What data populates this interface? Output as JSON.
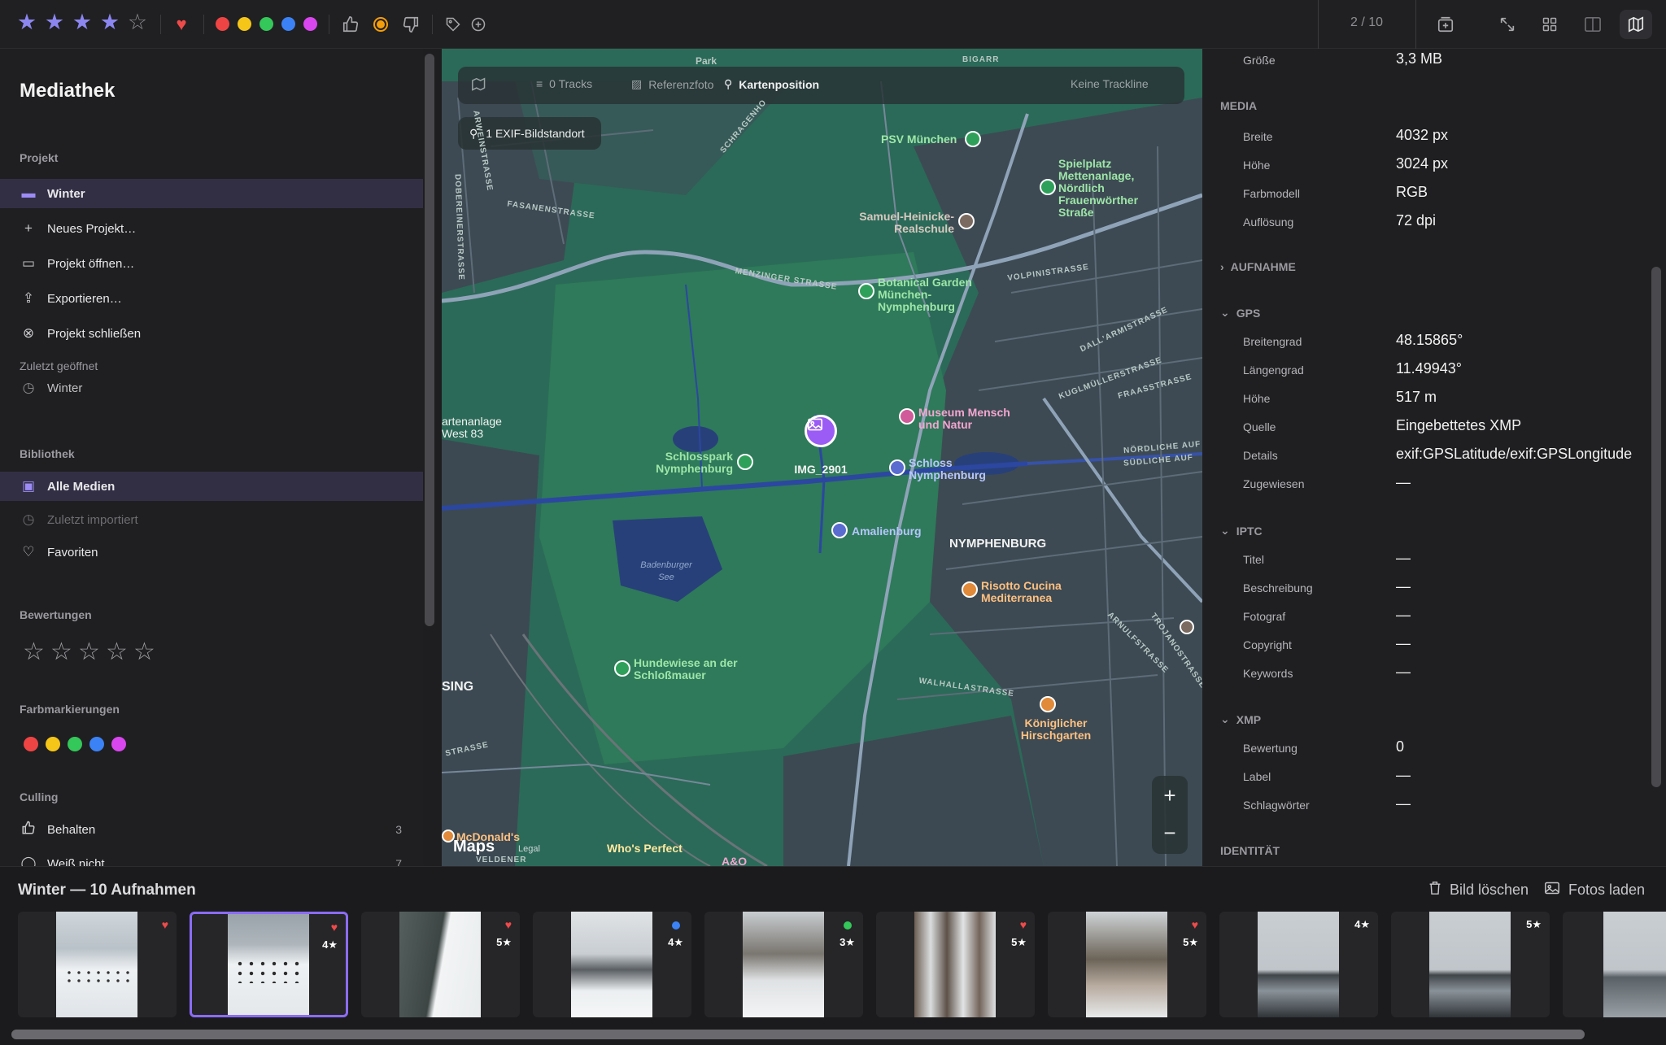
{
  "toolbar": {
    "rating_stars": [
      true,
      true,
      true,
      true,
      false
    ],
    "favorite_icon": "heart-icon",
    "color_labels": [
      "#ef4444",
      "#f5c518",
      "#34c759",
      "#3b82f6",
      "#d946ef"
    ],
    "counter": "2 / 10",
    "actions": [
      "thumbs-up-icon",
      "reject-circle-icon",
      "thumbs-down-icon",
      "tag-icon",
      "add-tag-icon"
    ],
    "right_buttons": [
      "import-icon",
      "fullscreen-icon",
      "grid-view-icon",
      "compare-view-icon",
      "map-view-icon"
    ]
  },
  "sidebar": {
    "title": "Mediathek",
    "project_heading": "Projekt",
    "project_items": [
      {
        "label": "Winter",
        "icon": "folder-icon",
        "selected": true
      },
      {
        "label": "Neues Projekt…",
        "icon": "plus-icon"
      },
      {
        "label": "Projekt öffnen…",
        "icon": "open-folder-icon"
      },
      {
        "label": "Exportieren…",
        "icon": "export-icon"
      },
      {
        "label": "Projekt schließen",
        "icon": "close-circle-icon"
      }
    ],
    "recent_heading": "Zuletzt geöffnet",
    "recent_items": [
      {
        "label": "Winter",
        "icon": "clock-icon"
      }
    ],
    "library_heading": "Bibliothek",
    "library_items": [
      {
        "label": "Alle Medien",
        "icon": "photos-icon",
        "selected": true
      },
      {
        "label": "Zuletzt importiert",
        "icon": "clock-icon",
        "disabled": true
      },
      {
        "label": "Favoriten",
        "icon": "heart-outline-icon"
      }
    ],
    "ratings_heading": "Bewertungen",
    "colors_heading": "Farbmarkierungen",
    "color_filters": [
      "#ef4444",
      "#f5c518",
      "#34c759",
      "#3b82f6",
      "#d946ef"
    ],
    "culling_heading": "Culling",
    "culling_items": [
      {
        "label": "Behalten",
        "count": "3",
        "icon": "thumbs-up-icon"
      },
      {
        "label": "Weiß nicht",
        "count": "7",
        "icon": "question-circle-icon"
      }
    ]
  },
  "map": {
    "bar": {
      "tracks": "0 Tracks",
      "reference": "Referenzfoto",
      "position": "Kartenposition",
      "trackline": "Keine Trackline"
    },
    "exif_pill": "1 EXIF-Bildstandort",
    "pin_label": "IMG_2901",
    "attribution": "Maps",
    "legal": "Legal",
    "labels": {
      "psv": "PSV München",
      "spielplatz": "Spielplatz Mettenanlage, Nördlich Frauenwörther Straße",
      "samuel": "Samuel-Heinicke-Realschule",
      "botanical": "Botanical Garden München-Nymphenburg",
      "museum": "Museum Mensch und Natur",
      "schlosspark": "Schlosspark Nymphenburg",
      "schloss": "Schloss Nymphenburg",
      "amalienburg": "Amalienburg",
      "nymphenburg": "NYMPHENBURG",
      "risotto": "Risotto Cucina Mediterranea",
      "hundewiese": "Hundewiese an der Schloßmauer",
      "koenig": "Königlicher Hirschgarten",
      "gartenanlage": "artenanlage West 83",
      "badenburger": "Badenburger See",
      "mcdonalds": "McDonald's",
      "whos": "Who's Perfect",
      "ao": "A&O",
      "sing": "SING"
    },
    "streets": {
      "menzinger": "MENZINGER STRASSE",
      "volpini": "VOLPINISTRASSE",
      "dall": "DALL'ARMISTRASSE",
      "kugl": "KUGLMÜLLERSTRASSE",
      "fraass": "FRAASSTRASSE",
      "nord": "NÖRDLICHE AUF",
      "sued": "SÜDLICHE AUF",
      "walhalla": "WALHALLASTRASSE",
      "arnulf": "ARNULFSTRASSE",
      "trojano": "TROJANOSTRASSE",
      "fasanen": "FASANENSTRASSE",
      "schragen": "SCHRAGENHO",
      "dobere": "DOBEREINERSTRASSE",
      "arwein": "ARWEINSTRASSE",
      "park": "Park",
      "bigarr": "BIGARR",
      "strasse": "STRASSE",
      "veldener": "VELDENER"
    }
  },
  "panel": {
    "top_rows": [
      {
        "key": "Größe",
        "value": "3,3 MB"
      }
    ],
    "media_heading": "MEDIA",
    "media_rows": [
      {
        "key": "Breite",
        "value": "4032 px"
      },
      {
        "key": "Höhe",
        "value": "3024 px"
      },
      {
        "key": "Farbmodell",
        "value": "RGB"
      },
      {
        "key": "Auflösung",
        "value": "72 dpi"
      }
    ],
    "aufnahme_heading": "AUFNAHME",
    "gps_heading": "GPS",
    "gps_rows": [
      {
        "key": "Breitengrad",
        "value": "48.15865°"
      },
      {
        "key": "Längengrad",
        "value": "11.49943°"
      },
      {
        "key": "Höhe",
        "value": "517 m"
      },
      {
        "key": "Quelle",
        "value": "Eingebettetes XMP"
      },
      {
        "key": "Details",
        "value": "exif:GPSLatitude/exif:GPSLongitude"
      },
      {
        "key": "Zugewiesen",
        "value": "—"
      }
    ],
    "iptc_heading": "IPTC",
    "iptc_rows": [
      {
        "key": "Titel",
        "value": "—"
      },
      {
        "key": "Beschreibung",
        "value": "—"
      },
      {
        "key": "Fotograf",
        "value": "—"
      },
      {
        "key": "Copyright",
        "value": "—"
      },
      {
        "key": "Keywords",
        "value": "—"
      }
    ],
    "xmp_heading": "XMP",
    "xmp_rows": [
      {
        "key": "Bewertung",
        "value": "0"
      },
      {
        "key": "Label",
        "value": "—"
      },
      {
        "key": "Schlagwörter",
        "value": "—"
      }
    ],
    "identity_heading": "IDENTITÄT"
  },
  "filmstrip": {
    "title": "Winter — 10 Aufnahmen",
    "delete_label": "Bild löschen",
    "load_label": "Fotos laden",
    "thumbs": [
      {
        "heart": true,
        "rating": "",
        "dot": "",
        "selected": false
      },
      {
        "heart": true,
        "rating": "4★",
        "dot": "",
        "selected": true
      },
      {
        "heart": true,
        "rating": "5★",
        "dot": "",
        "selected": false
      },
      {
        "heart": false,
        "rating": "4★",
        "dot": "#3b82f6",
        "selected": false
      },
      {
        "heart": false,
        "rating": "3★",
        "dot": "#34c759",
        "selected": false
      },
      {
        "heart": true,
        "rating": "5★",
        "dot": "",
        "selected": false
      },
      {
        "heart": true,
        "rating": "5★",
        "dot": "",
        "selected": false
      },
      {
        "heart": false,
        "rating": "4★",
        "dot": "",
        "selected": false
      },
      {
        "heart": false,
        "rating": "5★",
        "dot": "",
        "selected": false
      },
      {
        "heart": false,
        "rating": "",
        "dot": "",
        "selected": false
      }
    ]
  }
}
